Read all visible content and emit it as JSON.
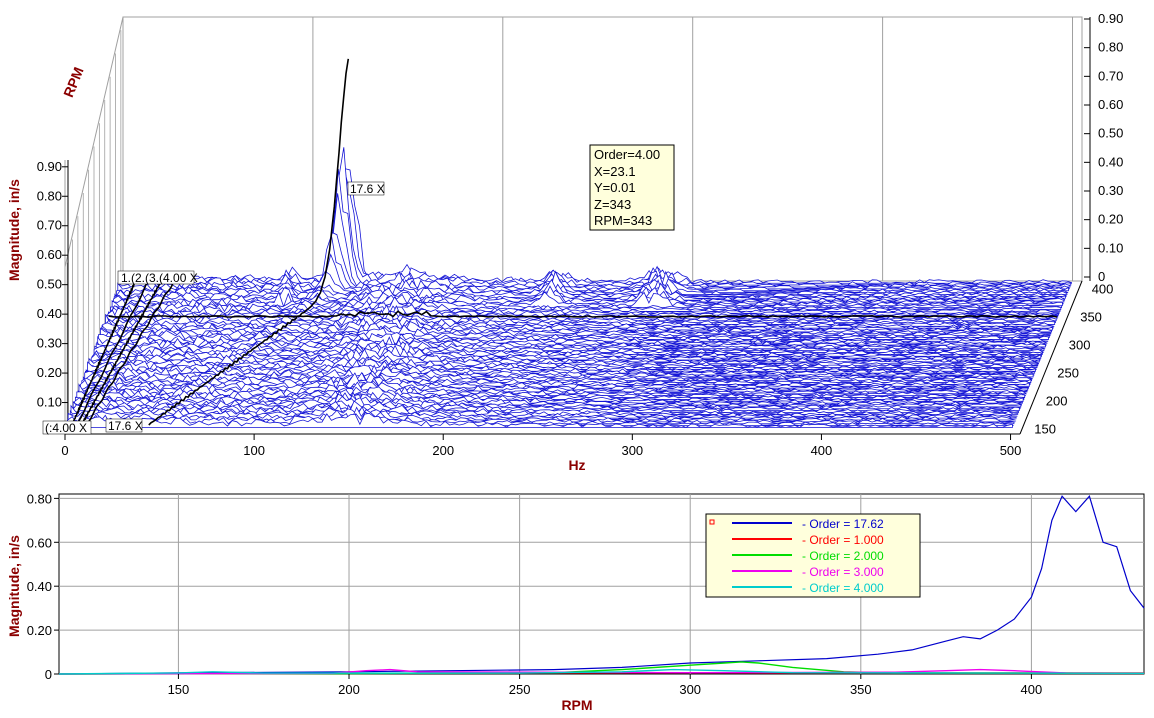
{
  "colors": {
    "axis_title": "#8b0000",
    "waterfall_trace": "#1515d6",
    "order_track": "#000000",
    "grid": "#a0a0a0"
  },
  "waterfall": {
    "x_label": "Hz",
    "y_label": "Magnitude, in/s",
    "z_label": "RPM",
    "x_ticks": [
      "0",
      "100",
      "200",
      "300",
      "400",
      "500"
    ],
    "y_ticks_left": [
      "0.10",
      "0.20",
      "0.30",
      "0.40",
      "0.50",
      "0.60",
      "0.70",
      "0.80",
      "0.90"
    ],
    "y_ticks_right": [
      "0",
      "0.10",
      "0.20",
      "0.30",
      "0.40",
      "0.50",
      "0.60",
      "0.70",
      "0.80",
      "0.90"
    ],
    "z_ticks": [
      "150",
      "200",
      "250",
      "300",
      "350",
      "400"
    ],
    "order_labels_top": "1.(2.(3.(4.00 X",
    "order_labels_bottom_left": "(:4.00 X",
    "order_labels_bottom": "17.6 X",
    "order_label_peak": "17.6 X",
    "cursor_info": [
      "Order=4.00",
      "X=23.1",
      "Y=0.01",
      "Z=343",
      "RPM=343"
    ]
  },
  "chart_data": {
    "type": "line",
    "xlabel": "RPM",
    "ylabel": "Magnitude, in/s",
    "xlim": [
      115,
      433
    ],
    "ylim": [
      0,
      0.82
    ],
    "x_ticks": [
      "150",
      "200",
      "250",
      "300",
      "350",
      "400"
    ],
    "y_ticks": [
      "0",
      "0.20",
      "0.40",
      "0.60",
      "0.80"
    ],
    "grid": true,
    "legend": "top-right",
    "series": [
      {
        "name": "- Order = 17.62",
        "color": "#0000cc",
        "x": [
          115,
          150,
          200,
          230,
          260,
          280,
          300,
          320,
          340,
          355,
          365,
          375,
          380,
          385,
          390,
          395,
          400,
          403,
          406,
          409,
          413,
          417,
          421,
          425,
          429,
          433
        ],
        "values": [
          0.0,
          0.005,
          0.01,
          0.015,
          0.02,
          0.03,
          0.05,
          0.06,
          0.07,
          0.09,
          0.11,
          0.15,
          0.17,
          0.16,
          0.2,
          0.25,
          0.35,
          0.48,
          0.7,
          0.81,
          0.74,
          0.81,
          0.6,
          0.58,
          0.38,
          0.3
        ]
      },
      {
        "name": "- Order = 1.000",
        "color": "#ff0000",
        "x": [
          115,
          200,
          300,
          350,
          433
        ],
        "values": [
          0.0,
          0.003,
          0.006,
          0.004,
          0.005
        ]
      },
      {
        "name": "- Order = 2.000",
        "color": "#00dd00",
        "x": [
          115,
          200,
          260,
          280,
          300,
          310,
          315,
          320,
          330,
          345,
          360,
          433
        ],
        "values": [
          0.0,
          0.002,
          0.006,
          0.02,
          0.04,
          0.05,
          0.055,
          0.05,
          0.03,
          0.01,
          0.005,
          0.003
        ]
      },
      {
        "name": "- Order = 3.000",
        "color": "#ee00ee",
        "x": [
          115,
          195,
          205,
          212,
          220,
          300,
          360,
          375,
          385,
          395,
          410,
          433
        ],
        "values": [
          0.0,
          0.003,
          0.015,
          0.02,
          0.01,
          0.006,
          0.008,
          0.015,
          0.02,
          0.015,
          0.005,
          0.003
        ]
      },
      {
        "name": "- Order = 4.000",
        "color": "#00cccc",
        "x": [
          115,
          150,
          160,
          175,
          250,
          280,
          295,
          310,
          330,
          433
        ],
        "values": [
          0.0,
          0.005,
          0.01,
          0.004,
          0.004,
          0.01,
          0.02,
          0.015,
          0.006,
          0.003
        ]
      }
    ]
  }
}
